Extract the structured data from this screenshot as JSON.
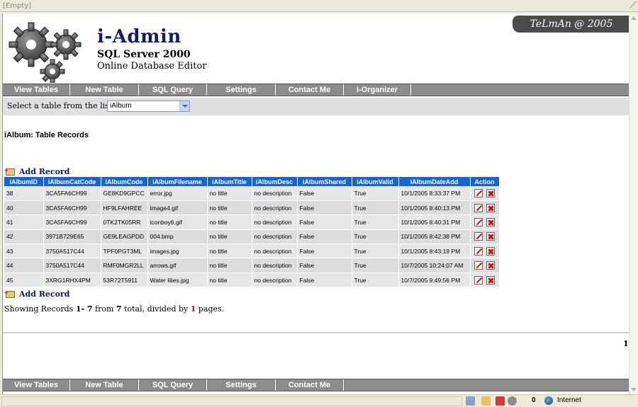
{
  "browser": {
    "title": "[Empty]",
    "zone": "Internet",
    "status_count": "0"
  },
  "header": {
    "title": "i-Admin",
    "subtitle": "SQL Server 2000",
    "tagline": "Online Database Editor",
    "credit": "TeLmAn @ 2005"
  },
  "menu": {
    "items": [
      "View Tables",
      "New Table",
      "SQL Query",
      "Settings",
      "Contact Me",
      "i-Organizer"
    ]
  },
  "footer_menu": {
    "items": [
      "View Tables",
      "New Table",
      "SQL Query",
      "Settings",
      "Contact Me"
    ]
  },
  "selector": {
    "label": "Select a table from the list:",
    "value": "iAlbum"
  },
  "section_title": "iAlbum: Table Records",
  "add_record_label": "Add Record",
  "table": {
    "columns": [
      "iAlbumID",
      "iAlbumCatCode",
      "iAlbumCode",
      "iAlbumFilename",
      "iAlbumTitle",
      "iAlbumDesc",
      "iAlbumShared",
      "iAlbumValid",
      "iAlbumDateAdd",
      "Action"
    ],
    "rows": [
      [
        "38",
        "3CA5FA6CH99",
        "GE8KD9GPCC",
        "error.jpg",
        "no title",
        "no description",
        "False",
        "True",
        "10/1/2005 8:33:37 PM"
      ],
      [
        "40",
        "3CA5FA6CH99",
        "HF9LFAHREE",
        "Image4.gif",
        "no title",
        "no description",
        "False",
        "True",
        "10/1/2005 8:40:13 PM"
      ],
      [
        "41",
        "3CA5FA6CH99",
        "0TK2TK05RR",
        "iconboy6.gif",
        "no title",
        "no description",
        "False",
        "True",
        "10/1/2005 8:40:31 PM"
      ],
      [
        "42",
        "3971B729E65",
        "GE9LEAGPDD",
        "004.bmp",
        "no title",
        "no description",
        "False",
        "True",
        "10/1/2005 8:42:38 PM"
      ],
      [
        "43",
        "3750A517C44",
        "TPF0PGT3ML",
        "images.jpg",
        "no title",
        "no description",
        "False",
        "True",
        "10/1/2005 8:43:19 PM"
      ],
      [
        "44",
        "3750A517C44",
        "RMF0MGR2LL",
        "arrows.gif",
        "no title",
        "no description",
        "False",
        "True",
        "10/7/2005 10:24:07 AM"
      ],
      [
        "45",
        "3XRG1RHX4PM",
        "53R72T5911",
        "Water lilies.jpg",
        "no title",
        "no description",
        "False",
        "True",
        "10/7/2005 9:49:56 PM"
      ]
    ]
  },
  "summary": {
    "prefix": "Showing Records",
    "range": "1- 7",
    "from_text": "from",
    "total": "7",
    "total_text": "total, divided by",
    "pages": "1",
    "pages_text": "pages."
  },
  "pagination": {
    "current": "1"
  },
  "colors": {
    "header_blue": "#1565d8",
    "menu_gray": "#8c8c8c",
    "brand_navy": "#101b6b",
    "accent_red": "#c81010"
  }
}
